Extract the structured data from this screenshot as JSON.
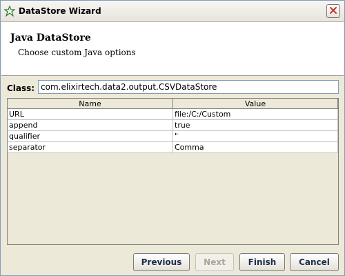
{
  "window": {
    "title": "DataStore Wizard"
  },
  "header": {
    "title": "Java DataStore",
    "subtitle": "Choose custom Java options"
  },
  "class_field": {
    "label": "Class:",
    "value": "com.elixirtech.data2.output.CSVDataStore"
  },
  "table": {
    "columns": [
      "Name",
      "Value"
    ],
    "rows": [
      {
        "name": "URL",
        "value": "file:/C:/Custom"
      },
      {
        "name": "append",
        "value": "true"
      },
      {
        "name": "qualifier",
        "value": "\""
      },
      {
        "name": "separator",
        "value": "Comma"
      }
    ]
  },
  "buttons": {
    "previous": "Previous",
    "next": "Next",
    "finish": "Finish",
    "cancel": "Cancel"
  },
  "icons": {
    "app": "wizard-star-icon",
    "close": "close-icon"
  },
  "colors": {
    "accent_close": "#c0392b",
    "button_text": "#1b2d4d",
    "disabled_text": "#a7a5a0"
  }
}
